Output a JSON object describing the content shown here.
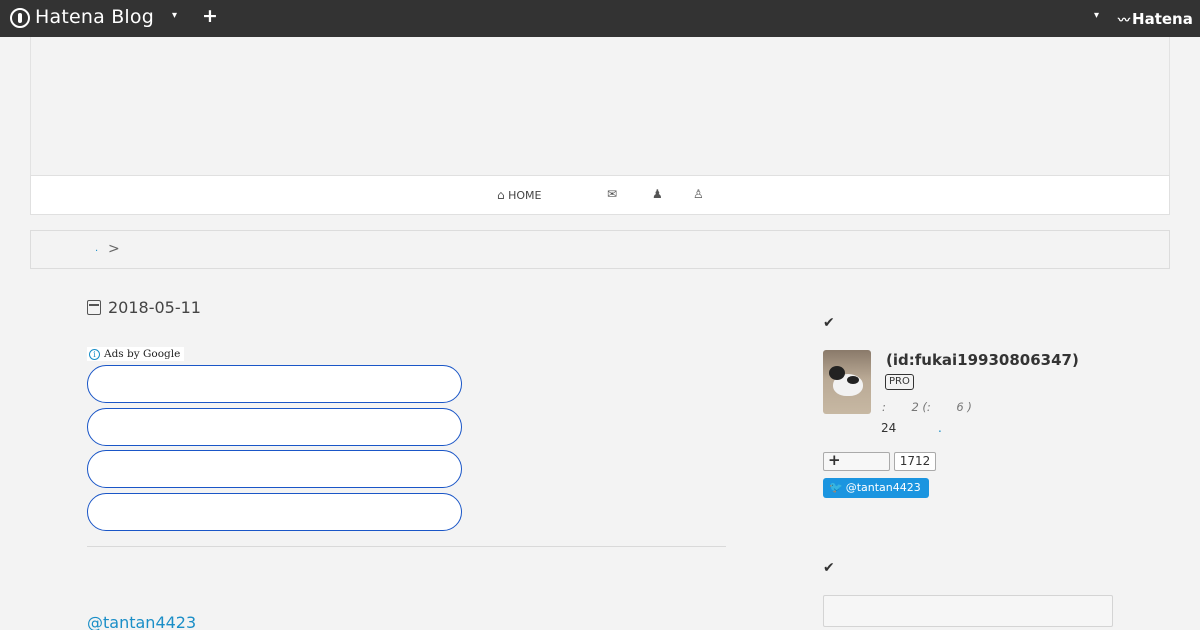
{
  "topbar": {
    "logo_text": "Hatena Blog",
    "add_icon": "plus-icon",
    "caret": "▾",
    "plus": "+",
    "hatena_label": "Hatena"
  },
  "nav": {
    "home_label": "HOME",
    "icons": [
      "home-icon",
      "envelope-icon",
      "user-icon",
      "person-icon"
    ]
  },
  "breadcrumb": {
    "link_text": ".",
    "separator": ">"
  },
  "entry": {
    "date": "2018-05-11",
    "ads_label": "Ads by Google",
    "ads_info": "i",
    "ad_link_count": 4,
    "twitter_mention": "@tantan4423"
  },
  "sidebar": {
    "profile": {
      "id_text": "(id:fukai19930806347)",
      "badge": "PRO",
      "stats_text": ":       2 (:       6 )",
      "count_text": "24",
      "dot_text": ".",
      "follow_count": "1712",
      "twitter_button": "@tantan4423"
    }
  },
  "colors": {
    "topbar_bg": "#333333",
    "page_bg": "#f3f3f3",
    "link": "#1a8ec7",
    "ad_border": "#1a56c7",
    "twitter": "#1b95e0"
  }
}
